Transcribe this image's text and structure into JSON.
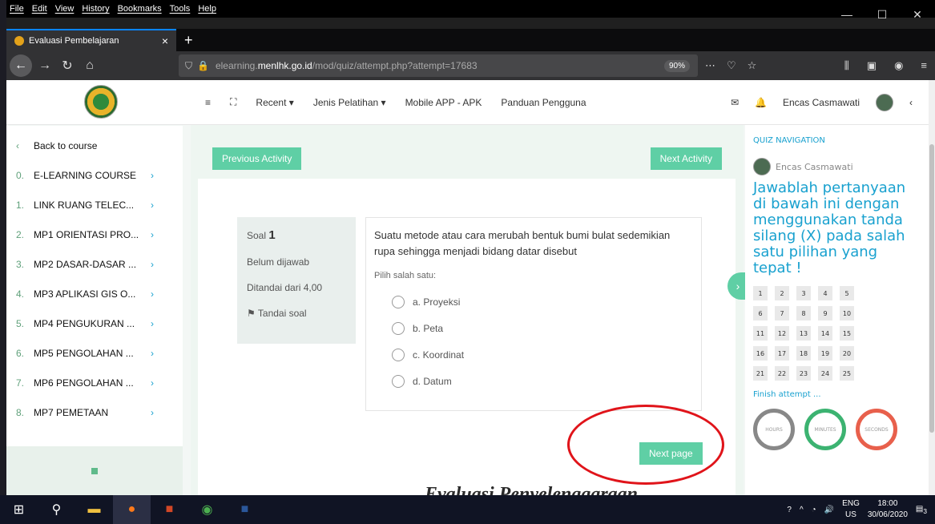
{
  "menubar": {
    "items": [
      "File",
      "Edit",
      "View",
      "History",
      "Bookmarks",
      "Tools",
      "Help"
    ]
  },
  "tab": {
    "title": "Evaluasi Pembelajaran",
    "close": "×",
    "new": "+"
  },
  "window_controls": {
    "min": "—",
    "max": "☐",
    "close": "✕"
  },
  "address": {
    "prefix": "elearning.",
    "host": "menlhk.go.id",
    "path": "/mod/quiz/attempt.php?attempt=17683",
    "zoom": "90%"
  },
  "site": {
    "nav": [
      "Recent ▾",
      "Jenis Pelatihan ▾",
      "Mobile APP - APK",
      "Panduan Pengguna"
    ],
    "user": "Encas Casmawati"
  },
  "leftnav": {
    "back": "Back to course",
    "items": [
      {
        "num": "0.",
        "label": "E-LEARNING COURSE"
      },
      {
        "num": "1.",
        "label": "LINK RUANG TELEC..."
      },
      {
        "num": "2.",
        "label": "MP1 ORIENTASI PRO..."
      },
      {
        "num": "3.",
        "label": "MP2 DASAR-DASAR ..."
      },
      {
        "num": "4.",
        "label": "MP3 APLIKASI GIS O..."
      },
      {
        "num": "5.",
        "label": "MP4 PENGUKURAN ..."
      },
      {
        "num": "6.",
        "label": "MP5 PENGOLAHAN ..."
      },
      {
        "num": "7.",
        "label": "MP6 PENGOLAHAN ..."
      },
      {
        "num": "8.",
        "label": "MP7 PEMETAAN"
      }
    ]
  },
  "activity": {
    "prev": "Previous Activity",
    "next": "Next Activity"
  },
  "question": {
    "soal": "Soal",
    "number": "1",
    "status": "Belum dijawab",
    "marks": "Ditandai dari 4,00",
    "flag": "Tandai soal",
    "text": "Suatu metode atau cara merubah bentuk bumi bulat sedemikian rupa sehingga menjadi bidang datar disebut",
    "prompt": "Pilih salah satu:",
    "options": [
      "a. Proyeksi",
      "b. Peta",
      "c. Koordinat",
      "d. Datum"
    ],
    "next_page": "Next page"
  },
  "quiz_nav": {
    "title": "QUIZ NAVIGATION",
    "user": "Encas Casmawati",
    "instructions": "Jawablah pertanyaan di bawah ini dengan menggunakan tanda silang (X) pada salah satu pilihan yang tepat !",
    "numbers": [
      "1",
      "2",
      "3",
      "4",
      "5",
      "6",
      "7",
      "8",
      "9",
      "10",
      "11",
      "12",
      "13",
      "14",
      "15",
      "16",
      "17",
      "18",
      "19",
      "20",
      "21",
      "22",
      "23",
      "24",
      "25"
    ],
    "finish": "Finish attempt ...",
    "timers": [
      "HOURS",
      "MINUTES",
      "SECONDS"
    ]
  },
  "background_text": "Evaluasi Penyelenggaraan",
  "taskbar": {
    "lang": "ENG",
    "region": "US",
    "time": "18:00",
    "date": "30/06/2020",
    "notif": "3"
  }
}
